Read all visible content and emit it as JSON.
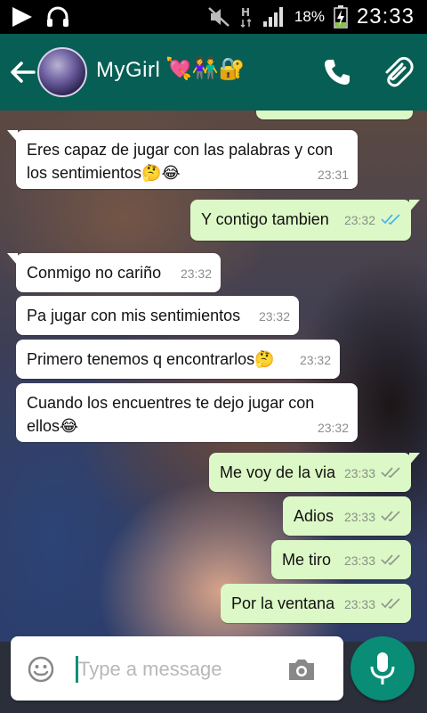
{
  "status_bar": {
    "battery_percent": "18%",
    "time": "23:33",
    "icons": [
      "play-icon",
      "headphones-icon",
      "mute-icon",
      "data-h-icon",
      "signal-icon",
      "battery-charging-icon"
    ]
  },
  "header": {
    "contact_name": "MyGirl",
    "name_emojis": "💘👫🔐",
    "icons": [
      "back-arrow-icon",
      "avatar",
      "phone-icon",
      "paperclip-icon"
    ]
  },
  "colors": {
    "header": "#075e54",
    "outgoing_bubble": "#dcf8c6",
    "incoming_bubble": "#ffffff",
    "read_ticks": "#4fb3ea",
    "mic_button": "#0a8d76"
  },
  "messages": [
    {
      "dir": "in",
      "text_line1": "Eres capaz de jugar con las palabras y con",
      "text_line2": "los sentimientos🤔😂",
      "time": "23:31"
    },
    {
      "dir": "out",
      "text": "Y contigo tambien",
      "time": "23:32",
      "status": "read"
    },
    {
      "dir": "in",
      "text": "Conmigo no cariño",
      "time": "23:32"
    },
    {
      "dir": "in",
      "text": "Pa jugar con mis sentimientos",
      "time": "23:32"
    },
    {
      "dir": "in",
      "text": "Primero tenemos q encontrarlos🤔",
      "time": "23:32"
    },
    {
      "dir": "in",
      "text_line1": "Cuando los encuentres te dejo jugar con",
      "text_line2": "ellos😂",
      "time": "23:32"
    },
    {
      "dir": "out",
      "text": "Me voy de la via",
      "time": "23:33",
      "status": "delivered"
    },
    {
      "dir": "out",
      "text": "Adios",
      "time": "23:33",
      "status": "delivered"
    },
    {
      "dir": "out",
      "text": "Me tiro",
      "time": "23:33",
      "status": "delivered"
    },
    {
      "dir": "out",
      "text": "Por la ventana",
      "time": "23:33",
      "status": "delivered"
    }
  ],
  "input": {
    "placeholder": "Type a message",
    "value": ""
  }
}
